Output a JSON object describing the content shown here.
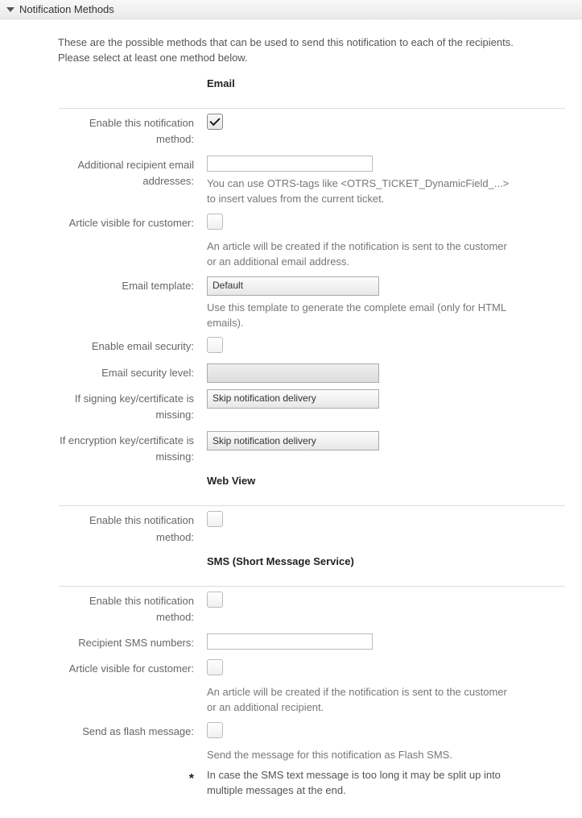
{
  "widget": {
    "title": "Notification Methods"
  },
  "intro": {
    "line1": "These are the possible methods that can be used to send this notification to each of the recipients.",
    "line2": "Please select at least one method below."
  },
  "sections": {
    "email": {
      "title": "Email",
      "enable_label": "Enable this notification method:",
      "additional_recipients_label": "Additional recipient email addresses:",
      "additional_recipients_value": "",
      "additional_recipients_help": "You can use OTRS-tags like <OTRS_TICKET_DynamicField_...> to insert values from the current ticket.",
      "article_visible_label": "Article visible for customer:",
      "article_visible_help": "An article will be created if the notification is sent to the customer or an additional email address.",
      "email_template_label": "Email template:",
      "email_template_value": "Default",
      "email_template_help": "Use this template to generate the complete email (only for HTML emails).",
      "enable_security_label": "Enable email security:",
      "security_level_label": "Email security level:",
      "security_level_value": "",
      "signing_key_label": "If signing key/certificate is missing:",
      "signing_key_value": "Skip notification delivery",
      "encryption_key_label": "If encryption key/certificate is missing:",
      "encryption_key_value": "Skip notification delivery"
    },
    "webview": {
      "title": "Web View",
      "enable_label": "Enable this notification method:"
    },
    "sms": {
      "title": "SMS (Short Message Service)",
      "enable_label": "Enable this notification method:",
      "recipient_numbers_label": "Recipient SMS numbers:",
      "recipient_numbers_value": "",
      "article_visible_label": "Article visible for customer:",
      "article_visible_help": "An article will be created if the notification is sent to the customer or an additional recipient.",
      "flash_label": "Send as flash message:",
      "flash_help": "Send the message for this notification as Flash SMS.",
      "asterisk": "*",
      "split_help": "In case the SMS text message is too long it may be split up into multiple messages at the end."
    }
  }
}
